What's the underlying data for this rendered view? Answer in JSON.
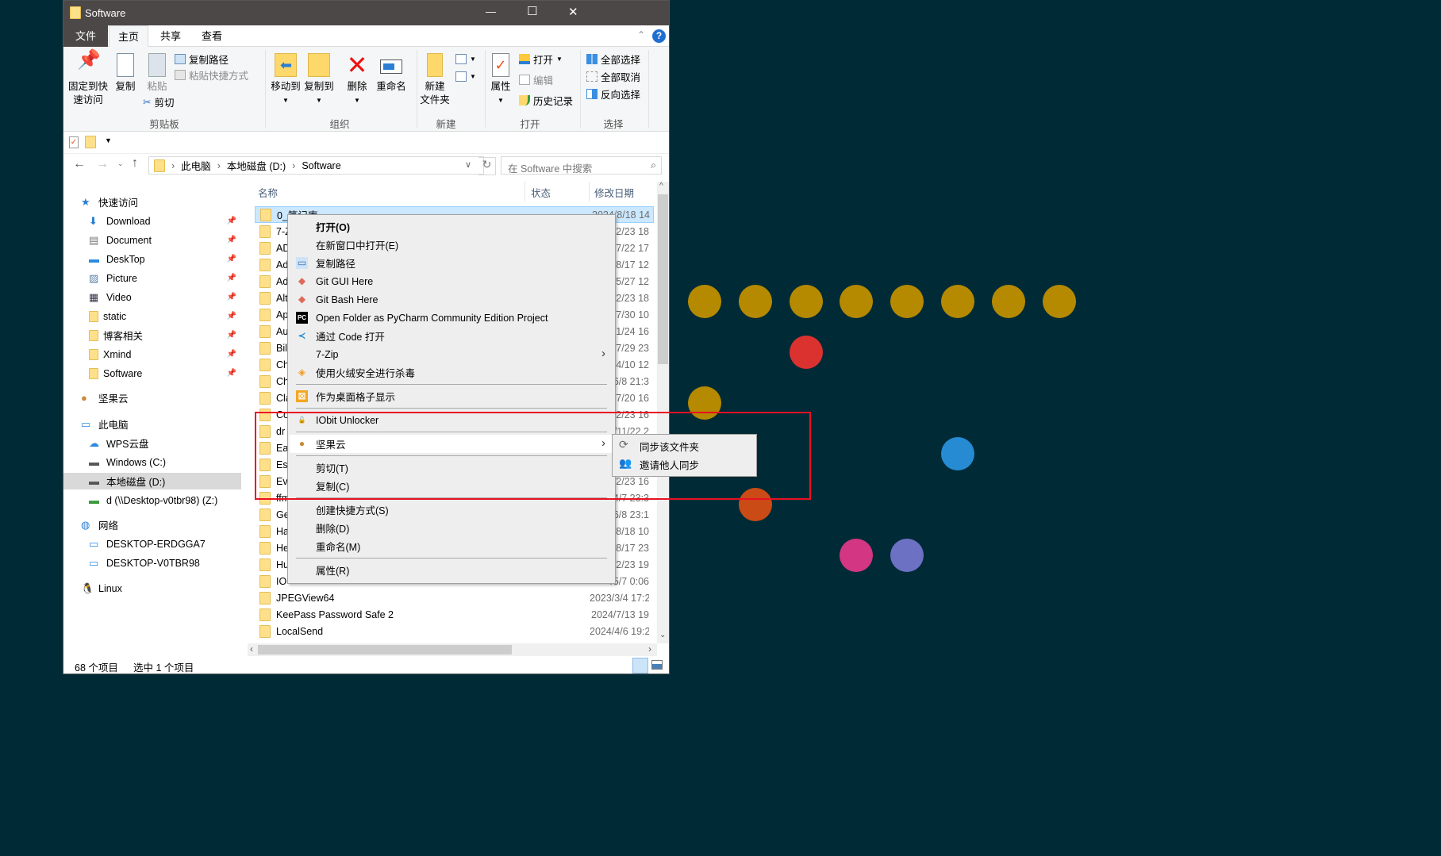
{
  "window": {
    "title": "Software",
    "minimize": "—",
    "maximize": "☐",
    "close": "✕"
  },
  "ribbon_tabs": [
    {
      "label": "文件"
    },
    {
      "label": "主页"
    },
    {
      "label": "共享"
    },
    {
      "label": "查看"
    }
  ],
  "ribbon": {
    "clipboard": {
      "pin": "固定到快",
      "pin2": "速访问",
      "copy": "复制",
      "paste": "粘贴",
      "copy_path": "复制路径",
      "paste_shortcut": "粘贴快捷方式",
      "cut": "剪切",
      "group": "剪贴板"
    },
    "organize": {
      "move_to": "移动到",
      "copy_to": "复制到",
      "delete": "删除",
      "rename": "重命名",
      "group": "组织"
    },
    "new": {
      "new_folder": "新建",
      "new_folder2": "文件夹",
      "group": "新建"
    },
    "open": {
      "properties": "属性",
      "open": "打开",
      "edit": "编辑",
      "history": "历史记录",
      "group": "打开"
    },
    "select": {
      "select_all": "全部选择",
      "select_none": "全部取消",
      "invert": "反向选择",
      "group": "选择"
    }
  },
  "address": {
    "crumbs": [
      "此电脑",
      "本地磁盘 (D:)",
      "Software"
    ],
    "search_placeholder": "在 Software 中搜索"
  },
  "columns": {
    "name": "名称",
    "status": "状态",
    "modified": "修改日期"
  },
  "sidebar": [
    {
      "label": "快速访问",
      "icon": "star-icon",
      "level": 0
    },
    {
      "label": "Download",
      "icon": "download-icon",
      "level": 1,
      "pinned": true
    },
    {
      "label": "Document",
      "icon": "document-icon",
      "level": 1,
      "pinned": true
    },
    {
      "label": "DeskTop",
      "icon": "desktop-icon",
      "level": 1,
      "pinned": true
    },
    {
      "label": "Picture",
      "icon": "picture-icon",
      "level": 1,
      "pinned": true
    },
    {
      "label": "Video",
      "icon": "video-icon",
      "level": 1,
      "pinned": true
    },
    {
      "label": "static",
      "icon": "folder-icon",
      "level": 1,
      "pinned": true
    },
    {
      "label": "博客相关",
      "icon": "folder-icon",
      "level": 1,
      "pinned": true
    },
    {
      "label": "Xmind",
      "icon": "folder-icon",
      "level": 1,
      "pinned": true
    },
    {
      "label": "Software",
      "icon": "folder-icon",
      "level": 1,
      "pinned": true
    },
    {
      "label": "坚果云",
      "icon": "nut-icon",
      "level": 0
    },
    {
      "label": "此电脑",
      "icon": "computer-icon",
      "level": 0
    },
    {
      "label": "WPS云盘",
      "icon": "cloud-icon",
      "level": 1
    },
    {
      "label": "Windows (C:)",
      "icon": "drive-icon",
      "level": 1
    },
    {
      "label": "本地磁盘 (D:)",
      "icon": "drive-icon",
      "level": 1,
      "selected": true
    },
    {
      "label": "d (\\\\Desktop-v0tbr98) (Z:)",
      "icon": "network-drive-icon",
      "level": 1
    },
    {
      "label": "网络",
      "icon": "network-icon",
      "level": 0
    },
    {
      "label": "DESKTOP-ERDGGA7",
      "icon": "computer-icon",
      "level": 1
    },
    {
      "label": "DESKTOP-V0TBR98",
      "icon": "computer-icon",
      "level": 1
    },
    {
      "label": "Linux",
      "icon": "linux-icon",
      "level": 0
    }
  ],
  "files": [
    {
      "name": "0_笔记库",
      "date": "2024/8/18 14"
    },
    {
      "name": "7-Z",
      "date": "/2/23 18"
    },
    {
      "name": "AD",
      "date": "/7/22 17"
    },
    {
      "name": "Ad",
      "date": "/8/17 12"
    },
    {
      "name": "Ad",
      "date": "/5/27 12"
    },
    {
      "name": "Alt",
      "date": "/2/23 18"
    },
    {
      "name": "Ap",
      "date": "/7/30 10"
    },
    {
      "name": "Au",
      "date": "/1/24 16"
    },
    {
      "name": "Bil",
      "date": "/7/29 23"
    },
    {
      "name": "Ch",
      "date": "/4/10 12"
    },
    {
      "name": "Ch",
      "date": "/6/8 21:3"
    },
    {
      "name": "Cla",
      "date": "/7/20 16"
    },
    {
      "name": "Co",
      "date": "/2/23 16"
    },
    {
      "name": "dr",
      "date": "/11/22 2"
    },
    {
      "name": "Ea",
      "date": ""
    },
    {
      "name": "Es",
      "date": ""
    },
    {
      "name": "Ev",
      "date": "/2/23 16"
    },
    {
      "name": "ffm",
      "date": "/4/7 23:3"
    },
    {
      "name": "Ge",
      "date": "/6/8 23:1"
    },
    {
      "name": "Ha",
      "date": "/8/18 10"
    },
    {
      "name": "He",
      "date": "/8/17 23"
    },
    {
      "name": "Hu",
      "date": "/2/23 19"
    },
    {
      "name": "IO",
      "date": "/5/7 0:06"
    },
    {
      "name": "JPEGView64",
      "date": "2023/3/4 17:2"
    },
    {
      "name": "KeePass Password Safe 2",
      "date": "2024/7/13 19"
    },
    {
      "name": "LocalSend",
      "date": "2024/4/6 19:2"
    }
  ],
  "context_menu": [
    {
      "label": "打开(O)",
      "bold": true
    },
    {
      "label": "在新窗口中打开(E)"
    },
    {
      "label": "复制路径",
      "icon": "copy-path-icon"
    },
    {
      "label": "Git GUI Here",
      "icon": "git-icon"
    },
    {
      "label": "Git Bash Here",
      "icon": "git-icon"
    },
    {
      "label": "Open Folder as PyCharm Community Edition Project",
      "icon": "pycharm-icon"
    },
    {
      "label": "通过 Code 打开",
      "icon": "vscode-icon"
    },
    {
      "label": "7-Zip",
      "submenu": true
    },
    {
      "label": "使用火绒安全进行杀毒",
      "icon": "huorong-icon"
    },
    {
      "sep": true
    },
    {
      "label": "作为桌面格子显示",
      "icon": "grid-icon"
    },
    {
      "sep": true
    },
    {
      "label": "IObit Unlocker",
      "icon": "unlock-icon"
    },
    {
      "sep": true
    },
    {
      "label": "坚果云",
      "icon": "nut-icon",
      "submenu": true,
      "highlighted": true
    },
    {
      "sep": true
    },
    {
      "label": "剪切(T)"
    },
    {
      "label": "复制(C)"
    },
    {
      "sep": true
    },
    {
      "label": "创建快捷方式(S)"
    },
    {
      "label": "删除(D)"
    },
    {
      "label": "重命名(M)"
    },
    {
      "sep": true
    },
    {
      "label": "属性(R)"
    }
  ],
  "submenu": [
    {
      "label": "同步该文件夹",
      "icon": "sync-icon"
    },
    {
      "label": "邀请他人同步",
      "icon": "users-icon"
    }
  ],
  "status": {
    "count": "68 个项目",
    "selected": "选中 1 个项目"
  },
  "colors": {
    "background": "#002b36",
    "highlight_box": "#e81123",
    "dots": [
      "#b58900",
      "#cb4b16",
      "#dc322f",
      "#d33682",
      "#6c71c4",
      "#268bd2",
      "#2aa198",
      "#859900"
    ]
  },
  "dots": [
    [
      1,
      1,
      1,
      1,
      1,
      1,
      1,
      1
    ],
    [
      0,
      0,
      3,
      0,
      0,
      0,
      0,
      0
    ],
    [
      1,
      0,
      0,
      0,
      0,
      0,
      0,
      0
    ],
    [
      0,
      0,
      0,
      0,
      0,
      6,
      0,
      0
    ],
    [
      0,
      2,
      0,
      0,
      0,
      0,
      0,
      0
    ],
    [
      0,
      0,
      0,
      4,
      5,
      0,
      0,
      0
    ]
  ]
}
